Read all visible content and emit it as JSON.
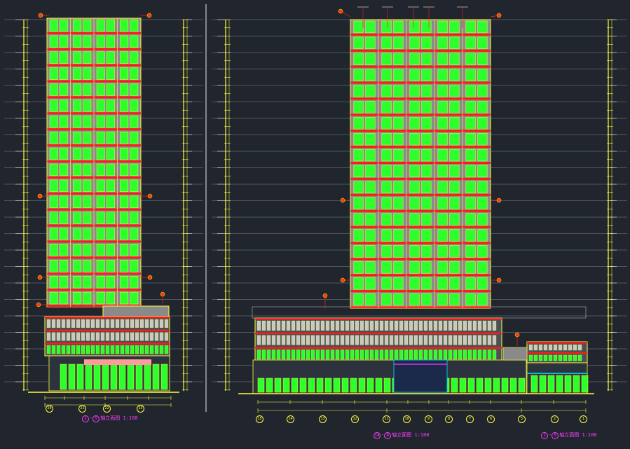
{
  "colors": {
    "background": "#21262e",
    "outline": "#ffff3c",
    "wall": "#8a8a8a",
    "slab": "#ff1a1a",
    "glass": "#2cff2c",
    "tag": "#ff3a00",
    "dim": "#e8e8e8",
    "caption": "#ff3cff",
    "cyan": "#00e5ff"
  },
  "drawing_1": {
    "title": "①-⑤轴立面图",
    "scale": "1:100",
    "caption_num_a": "1",
    "caption_num_b": "5",
    "caption_text": "轴立面图",
    "axis_labels": [
      "20",
      "21",
      "22",
      "23"
    ]
  },
  "drawing_2": {
    "title": "⑭-⑧轴立面图",
    "scale": "1:100",
    "caption_num_a": "14",
    "caption_num_b": "8",
    "caption_text": "轴立面图",
    "axis_labels": [
      "15",
      "14",
      "13",
      "12",
      "11",
      "10",
      "9",
      "8",
      "7",
      "6",
      "5"
    ]
  },
  "drawing_3": {
    "title": "①-⑤轴立面图",
    "scale": "1:100",
    "caption_num_a": "1",
    "caption_num_b": "5",
    "caption_text": "轴立面图",
    "axis_labels": [
      "2",
      "1"
    ]
  }
}
